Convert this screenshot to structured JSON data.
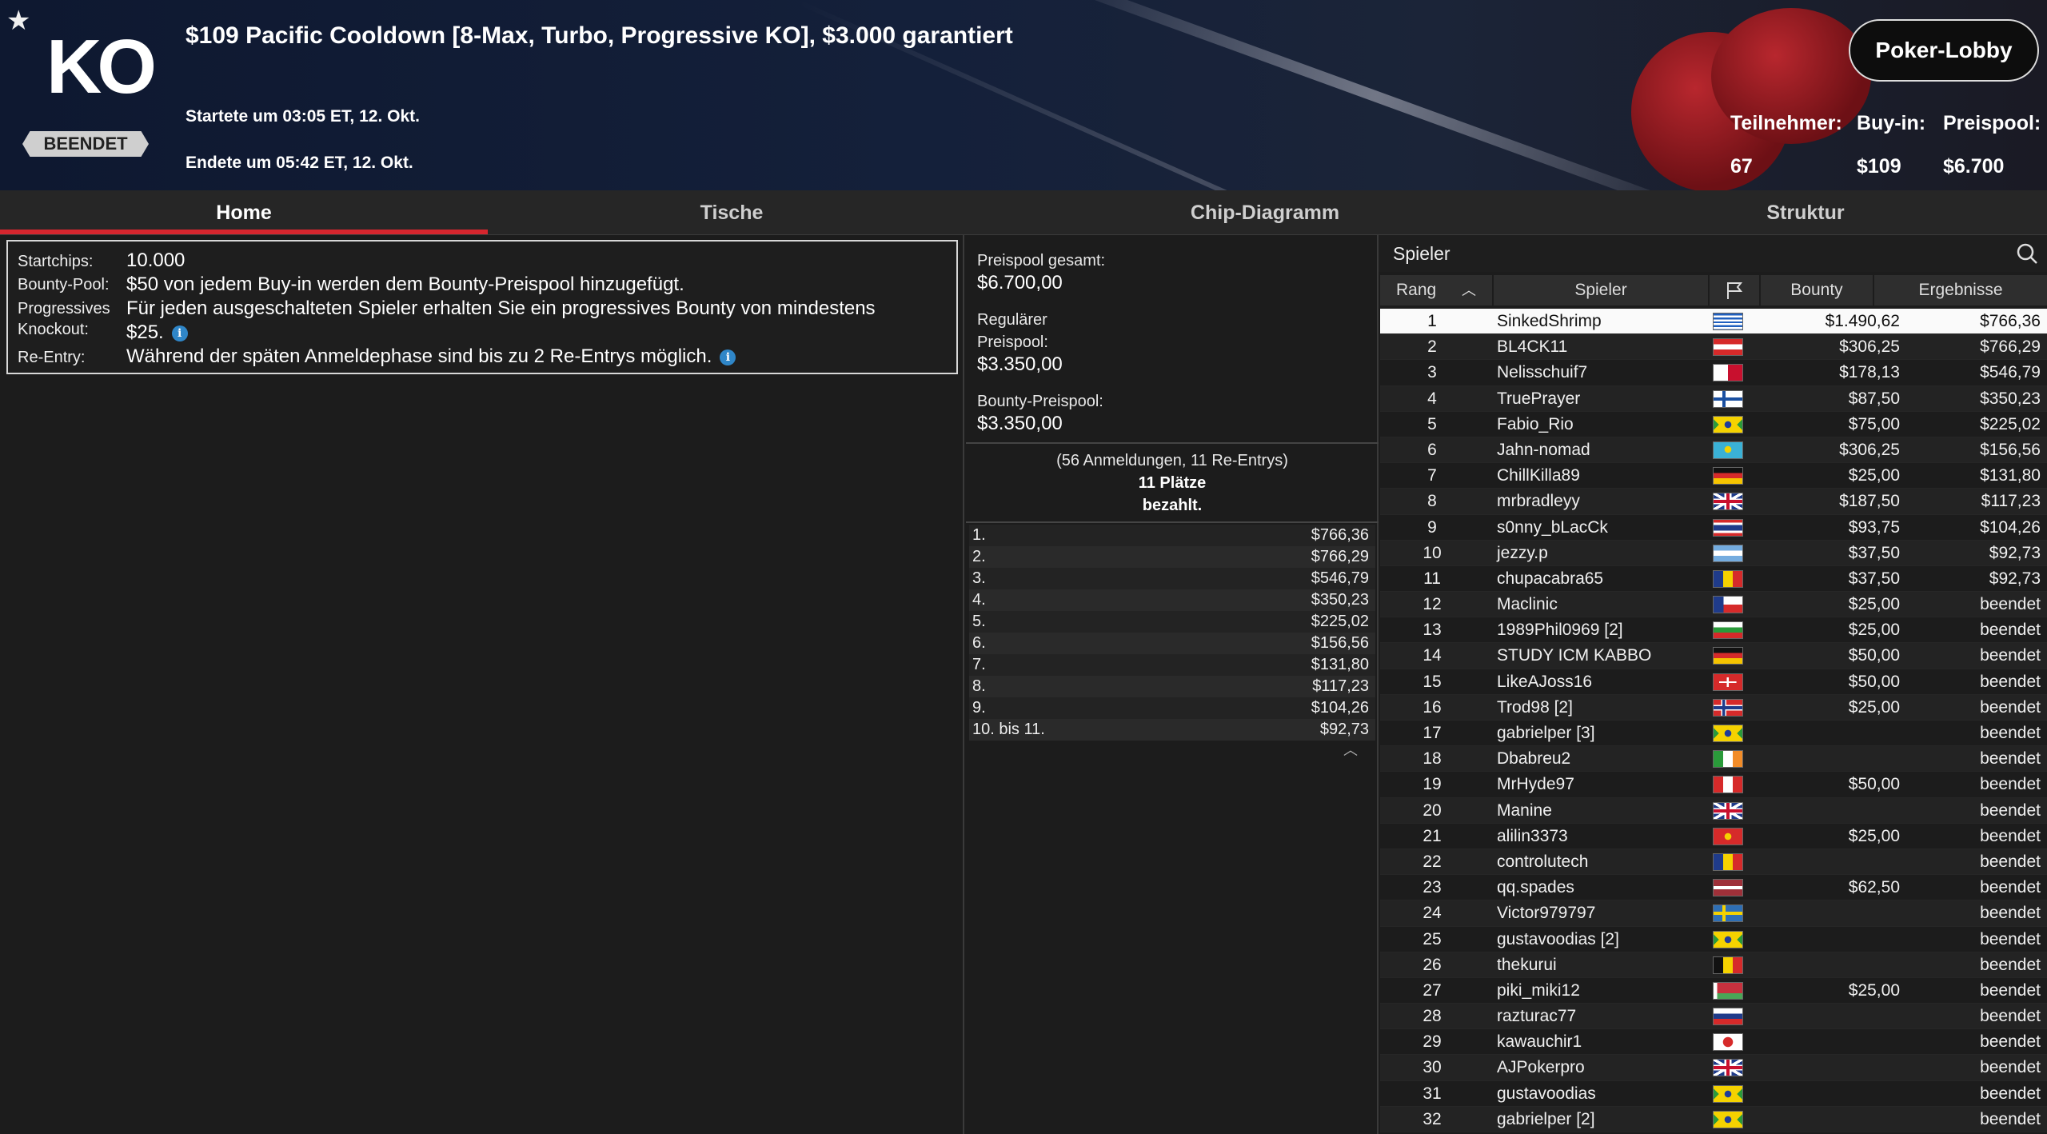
{
  "header": {
    "title": "$109 Pacific Cooldown [8-Max, Turbo, Progressive KO], $3.000 garantiert",
    "logo_text": "KO",
    "status_badge": "BEENDET",
    "start_time": "Startete um 03:05 ET, 12. Okt.",
    "end_time": "Endete um 05:42 ET, 12. Okt.",
    "lobby_button": "Poker-Lobby",
    "stats": [
      {
        "label": "Teilnehmer:",
        "value": "67"
      },
      {
        "label": "Buy-in:",
        "value": "$109"
      },
      {
        "label": "Preispool:",
        "value": "$6.700"
      }
    ]
  },
  "tabs": [
    {
      "label": "Home",
      "active": true
    },
    {
      "label": "Tische",
      "active": false
    },
    {
      "label": "Chip-Diagramm",
      "active": false
    },
    {
      "label": "Struktur",
      "active": false
    }
  ],
  "info": {
    "startchips_label": "Startchips:",
    "startchips_value": "10.000",
    "bountypool_label": "Bounty-Pool:",
    "bountypool_value": "$50 von jedem Buy-in werden dem Bounty-Preispool hinzugefügt.",
    "pko_label_1": "Progressives",
    "pko_label_2": "Knockout:",
    "pko_value_1": "Für jeden ausgeschalteten Spieler erhalten Sie ein progressives Bounty von mindestens",
    "pko_value_2": "$25.",
    "reentry_label": "Re-Entry:",
    "reentry_value": "Während der späten Anmeldephase sind bis zu 2 Re-Entrys möglich."
  },
  "prizepool": {
    "total_label": "Preispool gesamt:",
    "total_value": "$6.700,00",
    "regular_label_1": "Regulärer",
    "regular_label_2": "Preispool:",
    "regular_value": "$3.350,00",
    "bounty_label": "Bounty-Preispool:",
    "bounty_value": "$3.350,00",
    "entries_text": "(56 Anmeldungen, 11 Re-Entrys)",
    "paid_text_1": "11 Plätze",
    "paid_text_2": "bezahlt.",
    "payouts": [
      {
        "place": "1.",
        "amount": "$766,36"
      },
      {
        "place": "2.",
        "amount": "$766,29"
      },
      {
        "place": "3.",
        "amount": "$546,79"
      },
      {
        "place": "4.",
        "amount": "$350,23"
      },
      {
        "place": "5.",
        "amount": "$225,02"
      },
      {
        "place": "6.",
        "amount": "$156,56"
      },
      {
        "place": "7.",
        "amount": "$131,80"
      },
      {
        "place": "8.",
        "amount": "$117,23"
      },
      {
        "place": "9.",
        "amount": "$104,26"
      },
      {
        "place": "10. bis 11.",
        "amount": "$92,73"
      }
    ]
  },
  "players": {
    "title": "Spieler",
    "columns": {
      "rank": "Rang",
      "name": "Spieler",
      "bounty": "Bounty",
      "result": "Ergebnisse"
    },
    "rows": [
      {
        "rank": "1",
        "name": "SinkedShrimp",
        "flag": "gr",
        "bounty": "$1.490,62",
        "result": "$766,36"
      },
      {
        "rank": "2",
        "name": "BL4CK11",
        "flag": "at",
        "bounty": "$306,25",
        "result": "$766,29"
      },
      {
        "rank": "3",
        "name": "Nelisschuif7",
        "flag": "mt",
        "bounty": "$178,13",
        "result": "$546,79"
      },
      {
        "rank": "4",
        "name": "TruePrayer",
        "flag": "fi",
        "bounty": "$87,50",
        "result": "$350,23"
      },
      {
        "rank": "5",
        "name": "Fabio_Rio",
        "flag": "br",
        "bounty": "$75,00",
        "result": "$225,02"
      },
      {
        "rank": "6",
        "name": "Jahn-nomad",
        "flag": "kz",
        "bounty": "$306,25",
        "result": "$156,56"
      },
      {
        "rank": "7",
        "name": "ChillKilla89",
        "flag": "de",
        "bounty": "$25,00",
        "result": "$131,80"
      },
      {
        "rank": "8",
        "name": "mrbradleyy",
        "flag": "gb",
        "bounty": "$187,50",
        "result": "$117,23"
      },
      {
        "rank": "9",
        "name": "s0nny_bLacCk",
        "flag": "th",
        "bounty": "$93,75",
        "result": "$104,26"
      },
      {
        "rank": "10",
        "name": "jezzy.p",
        "flag": "ar",
        "bounty": "$37,50",
        "result": "$92,73"
      },
      {
        "rank": "11",
        "name": "chupacabra65",
        "flag": "ro",
        "bounty": "$37,50",
        "result": "$92,73"
      },
      {
        "rank": "12",
        "name": "Maclinic",
        "flag": "cl",
        "bounty": "$25,00",
        "result": "beendet"
      },
      {
        "rank": "13",
        "name": "1989Phil0969 [2]",
        "flag": "bg",
        "bounty": "$25,00",
        "result": "beendet"
      },
      {
        "rank": "14",
        "name": "STUDY ICM KABBO",
        "flag": "de",
        "bounty": "$50,00",
        "result": "beendet"
      },
      {
        "rank": "15",
        "name": "LikeAJoss16",
        "flag": "ch",
        "bounty": "$50,00",
        "result": "beendet"
      },
      {
        "rank": "16",
        "name": "Trod98 [2]",
        "flag": "no",
        "bounty": "$25,00",
        "result": "beendet"
      },
      {
        "rank": "17",
        "name": "gabrielper [3]",
        "flag": "br",
        "bounty": "",
        "result": "beendet"
      },
      {
        "rank": "18",
        "name": "Dbabreu2",
        "flag": "ie",
        "bounty": "",
        "result": "beendet"
      },
      {
        "rank": "19",
        "name": "MrHyde97",
        "flag": "pe",
        "bounty": "$50,00",
        "result": "beendet"
      },
      {
        "rank": "20",
        "name": "Manine",
        "flag": "gb",
        "bounty": "",
        "result": "beendet"
      },
      {
        "rank": "21",
        "name": "alilin3373",
        "flag": "vn",
        "bounty": "$25,00",
        "result": "beendet"
      },
      {
        "rank": "22",
        "name": "controlutech",
        "flag": "ro",
        "bounty": "",
        "result": "beendet"
      },
      {
        "rank": "23",
        "name": "qq.spades",
        "flag": "lv",
        "bounty": "$62,50",
        "result": "beendet"
      },
      {
        "rank": "24",
        "name": "Victor979797",
        "flag": "se",
        "bounty": "",
        "result": "beendet"
      },
      {
        "rank": "25",
        "name": "gustavoodias [2]",
        "flag": "br",
        "bounty": "",
        "result": "beendet"
      },
      {
        "rank": "26",
        "name": "thekurui",
        "flag": "be",
        "bounty": "",
        "result": "beendet"
      },
      {
        "rank": "27",
        "name": "piki_miki12",
        "flag": "by",
        "bounty": "$25,00",
        "result": "beendet"
      },
      {
        "rank": "28",
        "name": "razturac77",
        "flag": "si",
        "bounty": "",
        "result": "beendet"
      },
      {
        "rank": "29",
        "name": "kawauchir1",
        "flag": "jp",
        "bounty": "",
        "result": "beendet"
      },
      {
        "rank": "30",
        "name": "AJPokerpro",
        "flag": "gb",
        "bounty": "",
        "result": "beendet"
      },
      {
        "rank": "31",
        "name": "gustavoodias",
        "flag": "br",
        "bounty": "",
        "result": "beendet"
      },
      {
        "rank": "32",
        "name": "gabrielper [2]",
        "flag": "br",
        "bounty": "",
        "result": "beendet"
      }
    ]
  },
  "colors": {
    "accent_red": "#d6262e",
    "info_blue": "#2f86c8",
    "background": "#1c1c1c"
  }
}
